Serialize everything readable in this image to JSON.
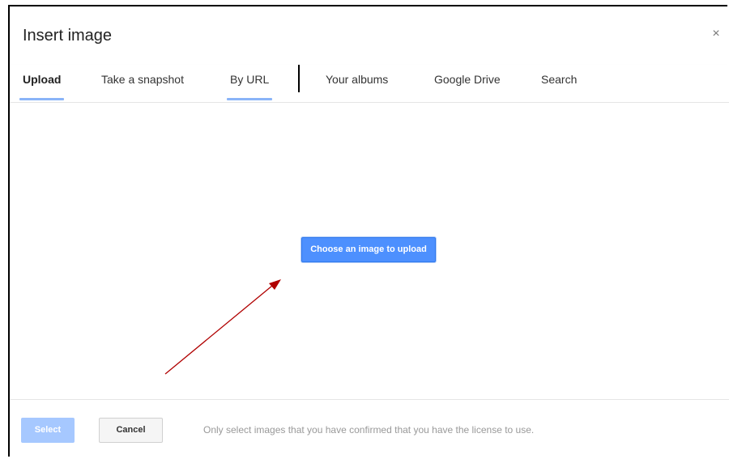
{
  "dialog": {
    "title": "Insert image",
    "close_label": "×"
  },
  "tabs": [
    {
      "label": "Upload",
      "active": true
    },
    {
      "label": "Take a snapshot",
      "active": false
    },
    {
      "label": "By URL",
      "active": false
    },
    {
      "label": "Your albums",
      "active": false
    },
    {
      "label": "Google Drive",
      "active": false
    },
    {
      "label": "Search",
      "active": false
    }
  ],
  "content": {
    "choose_button_label": "Choose an image to upload"
  },
  "footer": {
    "select_label": "Select",
    "cancel_label": "Cancel",
    "license_note": "Only select images that you have confirmed that you have the license to use."
  },
  "colors": {
    "accent_blue": "#4d90fe",
    "tab_underline": "#8ab4f8",
    "disabled_blue": "#a6c8ff",
    "annotation_arrow": "#b00000"
  },
  "icons": {
    "close": "close-icon"
  }
}
